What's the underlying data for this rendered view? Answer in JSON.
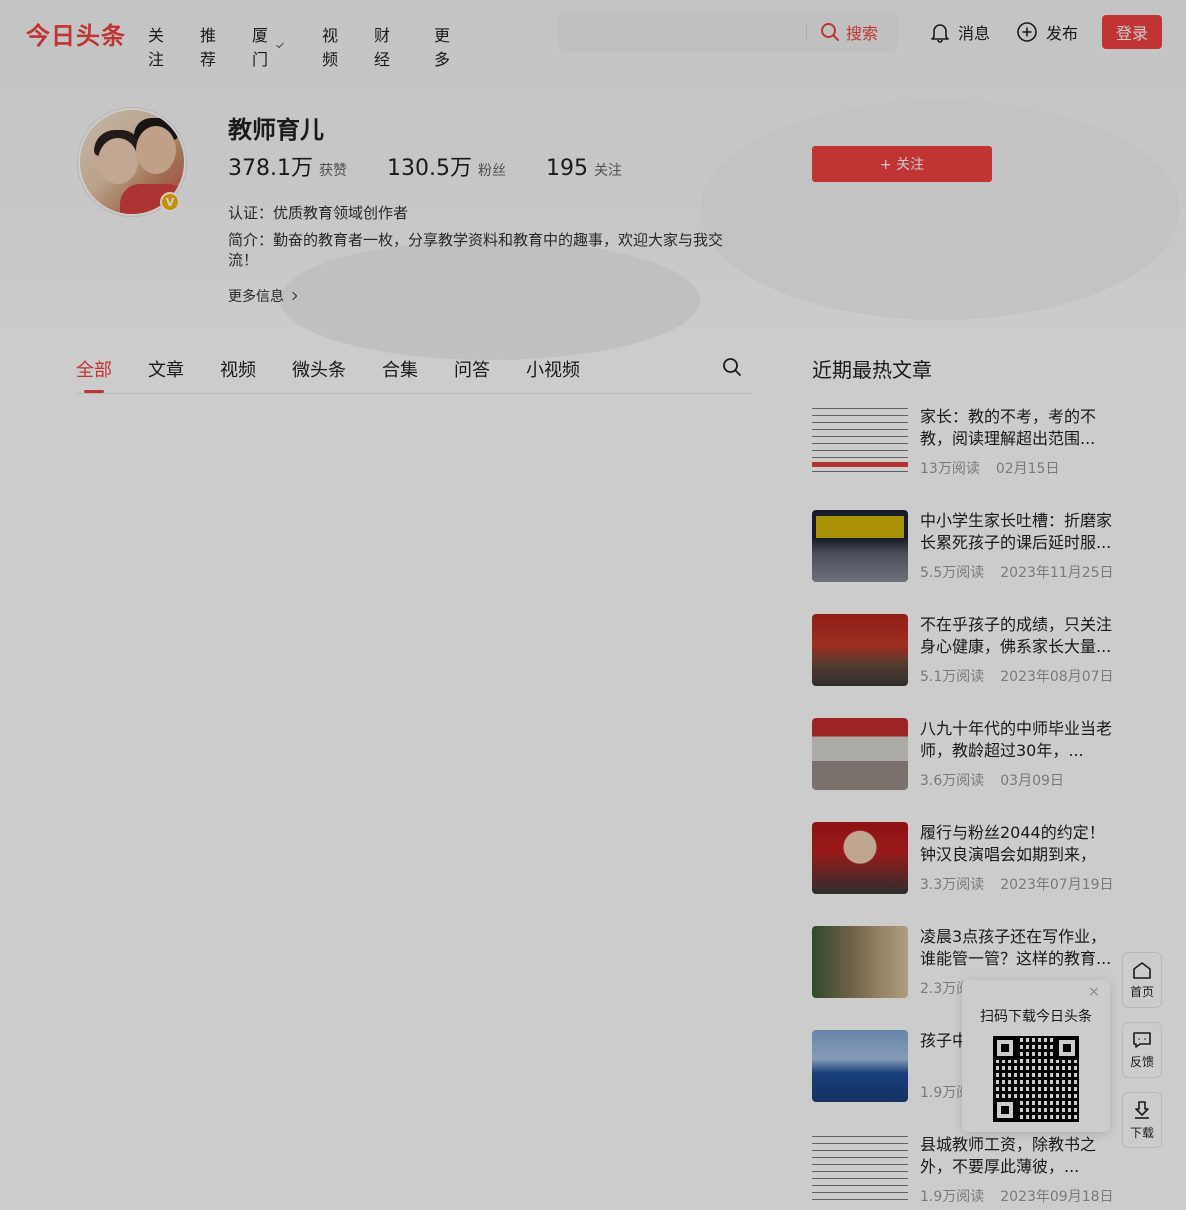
{
  "header": {
    "logo": "今日头条",
    "nav": [
      "关注",
      "推荐",
      "厦门",
      "视频",
      "财经",
      "更多"
    ],
    "search_placeholder": "",
    "search_button": "搜索",
    "messages": "消息",
    "publish": "发布",
    "login": "登录"
  },
  "profile": {
    "name": "教师育儿",
    "verified_badge": "V",
    "stats": [
      {
        "num": "378.1万",
        "label": "获赞"
      },
      {
        "num": "130.5万",
        "label": "粉丝"
      },
      {
        "num": "195",
        "label": "关注"
      }
    ],
    "certification": "认证：优质教育领域创作者",
    "intro": "简介：勤奋的教育者一枚，分享教学资料和教育中的趣事，欢迎大家与我交流！",
    "more_info": "更多信息",
    "follow_button": "+ 关注"
  },
  "tabs": [
    "全部",
    "文章",
    "视频",
    "微头条",
    "合集",
    "问答",
    "小视频"
  ],
  "sidebar": {
    "title": "近期最热文章",
    "articles": [
      {
        "title": "家长：教的不考，考的不教，阅读理解超出范围...",
        "reads": "13万阅读",
        "date": "02月15日"
      },
      {
        "title": "中小学生家长吐槽：折磨家长累死孩子的课后延时服...",
        "reads": "5.5万阅读",
        "date": "2023年11月25日"
      },
      {
        "title": "不在乎孩子的成绩，只关注身心健康，佛系家长大量...",
        "reads": "5.1万阅读",
        "date": "2023年08月07日"
      },
      {
        "title": "八九十年代的中师毕业当老师，教龄超过30年，...",
        "reads": "3.6万阅读",
        "date": "03月09日"
      },
      {
        "title": "履行与粉丝2044的约定！钟汉良演唱会如期到来，5...",
        "reads": "3.3万阅读",
        "date": "2023年07月19日"
      },
      {
        "title": "凌晨3点孩子还在写作业，谁能管一管？这样的教育...",
        "reads": "2.3万阅读",
        "date": ""
      },
      {
        "title": "孩子中考挑选职...",
        "reads": "1.9万阅读",
        "date": ""
      },
      {
        "title": "县城教师工资，除教书之外，不要厚此薄彼，...",
        "reads": "1.9万阅读",
        "date": "2023年09月18日"
      }
    ]
  },
  "floaters": {
    "home": "首页",
    "feedback": "反馈",
    "download": "下载",
    "qr_title": "扫码下载今日头条",
    "qr_close": "×"
  }
}
